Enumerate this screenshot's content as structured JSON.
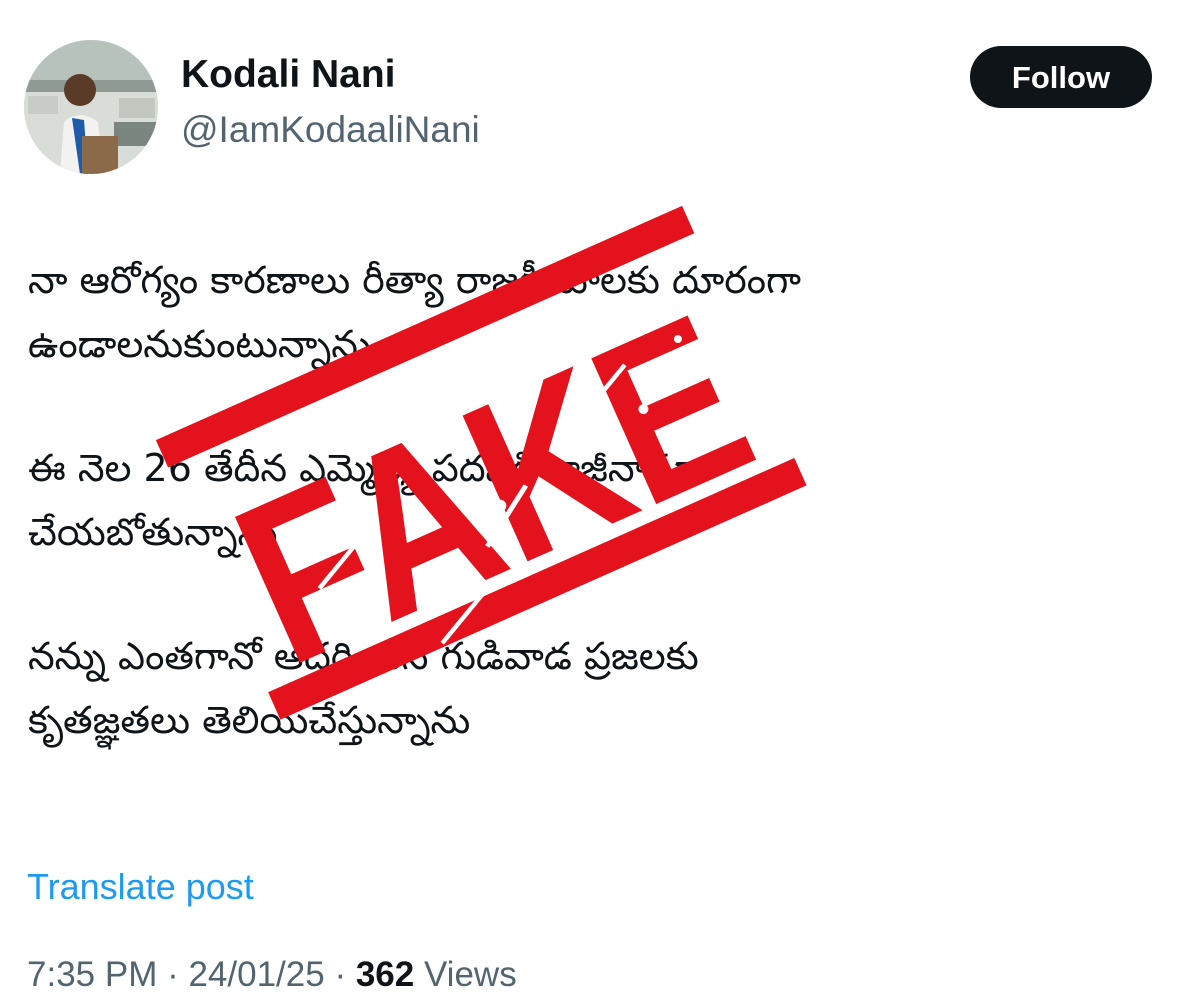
{
  "author": {
    "display_name": "Kodali Nani",
    "handle": "@IamKodaaliNani"
  },
  "follow_button": {
    "label": "Follow"
  },
  "post": {
    "paragraphs": [
      [
        "నా ఆరోగ్యం కారణాలు రీత్యా రాజకీయాలకు దూరంగా",
        "ఉండాలనుకుంటున్నాను"
      ],
      [
        "ఈ నెల 26 తేదీన ఎమ్మెల్యే పదవికి రాజీనామా",
        "చేయబోతున్నాను"
      ],
      [
        "నన్ను ఎంతగానో ఆదరించిన గుడివాడ ప్రజలకు",
        "కృతజ్ఞతలు తెలియచేస్తున్నాను"
      ]
    ]
  },
  "translate_link": "Translate post",
  "meta": {
    "time": "7:35 PM",
    "separator": " · ",
    "date": "24/01/25",
    "views_count": "362",
    "views_label": " Views"
  },
  "stamp": {
    "text": "FAKE",
    "color": "#e3121c"
  },
  "colors": {
    "text_primary": "#0f1419",
    "text_secondary": "#536471",
    "link": "#1d9bf0",
    "follow_bg": "#0f1419"
  }
}
